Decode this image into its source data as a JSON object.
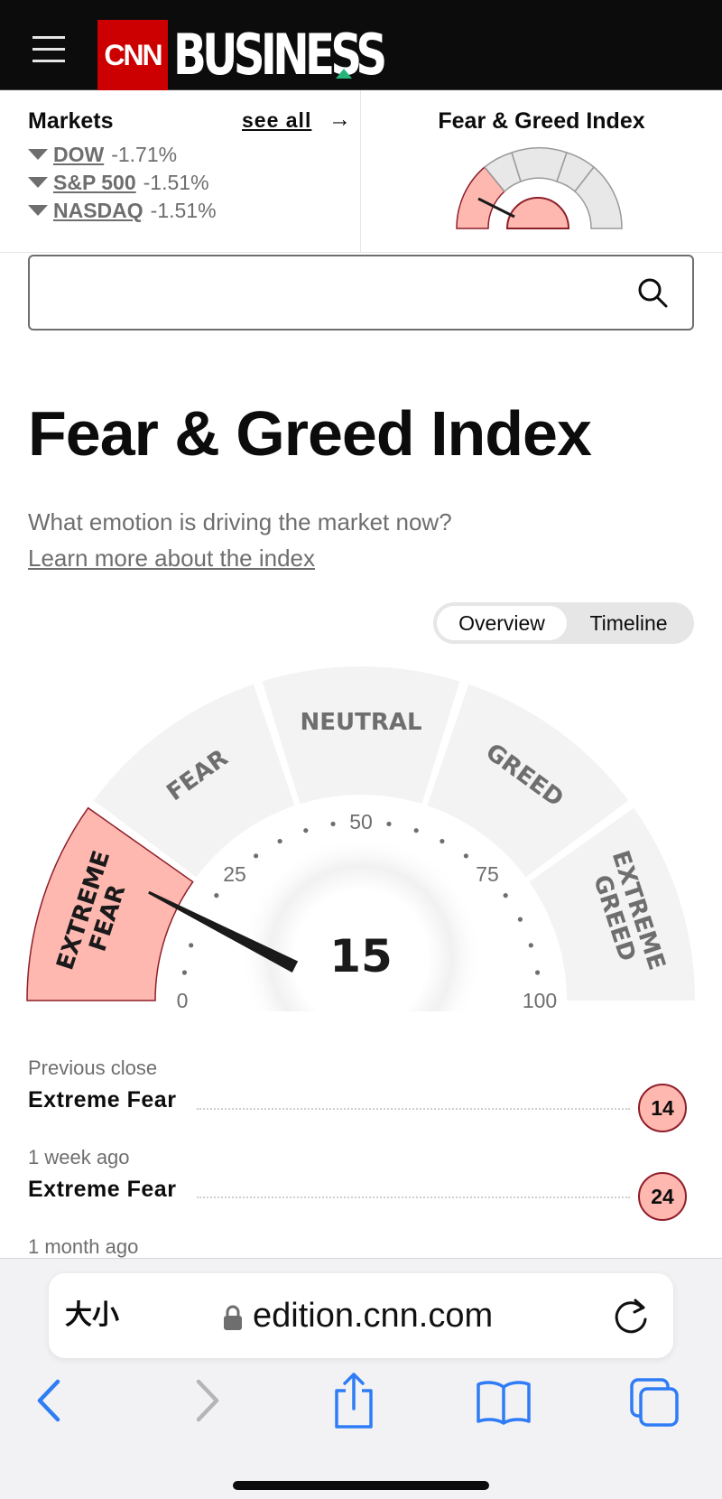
{
  "nav": {
    "cnn_logo": "CNN",
    "section": "BUSINESS"
  },
  "markets": {
    "title": "Markets",
    "see_all": "see all",
    "indices": [
      {
        "name": "DOW",
        "change": "-1.71%"
      },
      {
        "name": "S&P 500",
        "change": "-1.51%"
      },
      {
        "name": "NASDAQ",
        "change": "-1.51%"
      }
    ],
    "fg_widget_title": "Fear & Greed Index"
  },
  "search": {
    "placeholder": ""
  },
  "page": {
    "title": "Fear & Greed Index",
    "subtitle": "What emotion is driving the market now?",
    "learn_link": "Learn more about the index"
  },
  "toggle": {
    "overview": "Overview",
    "timeline": "Timeline",
    "selected": "Overview"
  },
  "gauge": {
    "value": 15,
    "value_text": "15",
    "segments": [
      "EXTREME FEAR",
      "FEAR",
      "NEUTRAL",
      "GREED",
      "EXTREME GREED"
    ],
    "active_segment": "EXTREME FEAR",
    "ticks": [
      "0",
      "25",
      "50",
      "75",
      "100"
    ],
    "colors": {
      "active_fill": "#ffb8b0",
      "active_stroke": "#8e1e2a",
      "inactive_fill": "#f3f3f3",
      "needle": "#1a1a1a",
      "label": "#6e6e6e"
    }
  },
  "history": [
    {
      "label": "Previous close",
      "value": "Extreme Fear",
      "score": "14"
    },
    {
      "label": "1 week ago",
      "value": "Extreme Fear",
      "score": "24"
    },
    {
      "label": "1 month ago"
    }
  ],
  "browser": {
    "text_size_label": "大小",
    "url": "edition.cnn.com",
    "toolbar": [
      "back-icon",
      "forward-icon",
      "share-icon",
      "bookmarks-icon",
      "tabs-icon"
    ]
  }
}
